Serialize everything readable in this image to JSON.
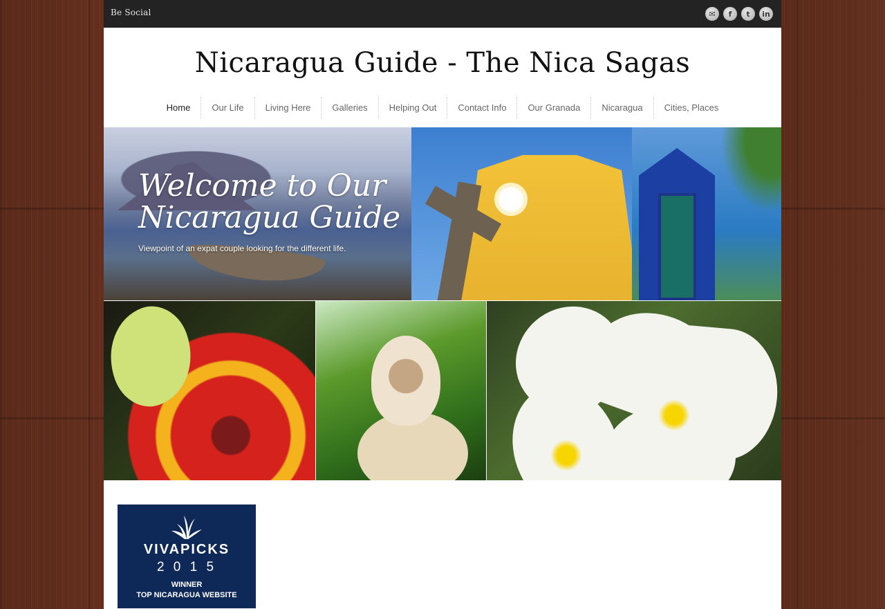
{
  "topbar": {
    "be_social": "Be Social",
    "icons": [
      "email-icon",
      "facebook-icon",
      "twitter-icon",
      "linkedin-icon"
    ]
  },
  "header": {
    "title": "Nicaragua Guide - The Nica Sagas"
  },
  "nav": {
    "items": [
      {
        "label": "Home",
        "active": true
      },
      {
        "label": "Our Life"
      },
      {
        "label": "Living Here"
      },
      {
        "label": "Galleries"
      },
      {
        "label": "Helping Out"
      },
      {
        "label": "Contact Info"
      },
      {
        "label": "Our Granada"
      },
      {
        "label": "Nicaragua"
      },
      {
        "label": "Cities, Places"
      }
    ]
  },
  "banner": {
    "heading": "Welcome to Our Nicaragua Guide",
    "subtitle": "Viewpoint of an expat couple looking for the different life."
  },
  "award": {
    "name": "VIVAPICKS",
    "year": "2 0 1 5",
    "winner": "WINNER",
    "description": "TOP NICARAGUA WEBSITE"
  },
  "colors": {
    "topbar": "#232323",
    "award_bg": "#0e2858",
    "nav_text": "#666666"
  }
}
